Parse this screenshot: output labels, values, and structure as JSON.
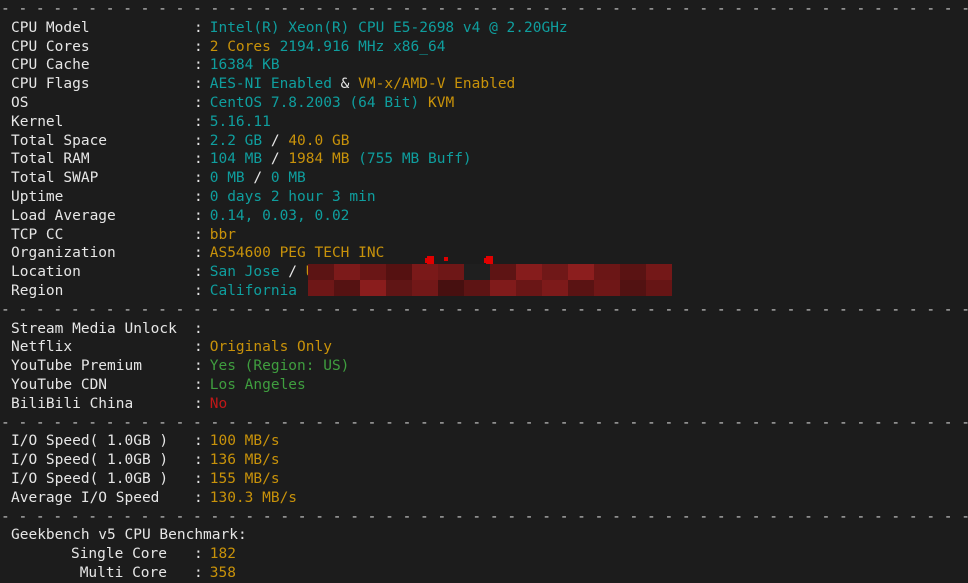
{
  "terminal": {
    "background": "#1c1c1c",
    "colors": {
      "white": "#e6e6e6",
      "cyan": "#0f9e9e",
      "yellow": "#c8920a",
      "green": "#3f9e3f",
      "red": "#c01818",
      "redaction": "#7a1010"
    },
    "divider": "-------------------------------------------------------------",
    "sections": {
      "system": {
        "rows": [
          {
            "label": "CPU Model",
            "parts": [
              {
                "t": "Intel(R) Xeon(R) CPU E5-2698 v4 @ 2.20GHz",
                "c": "cyan"
              }
            ]
          },
          {
            "label": "CPU Cores",
            "parts": [
              {
                "t": "2 Cores",
                "c": "yellow"
              },
              {
                "t": " ",
                "c": "white"
              },
              {
                "t": "2194.916 MHz x86_64",
                "c": "cyan"
              }
            ]
          },
          {
            "label": "CPU Cache",
            "parts": [
              {
                "t": "16384 KB",
                "c": "cyan"
              }
            ]
          },
          {
            "label": "CPU Flags",
            "parts": [
              {
                "t": "AES-NI Enabled",
                "c": "cyan"
              },
              {
                "t": " & ",
                "c": "white"
              },
              {
                "t": "VM-x/AMD-V Enabled",
                "c": "yellow"
              }
            ]
          },
          {
            "label": "OS",
            "parts": [
              {
                "t": "CentOS 7.8.2003 (64 Bit) ",
                "c": "cyan"
              },
              {
                "t": "KVM",
                "c": "yellow"
              }
            ]
          },
          {
            "label": "Kernel",
            "parts": [
              {
                "t": "5.16.11",
                "c": "cyan"
              }
            ]
          },
          {
            "label": "Total Space",
            "parts": [
              {
                "t": "2.2 GB",
                "c": "cyan"
              },
              {
                "t": " / ",
                "c": "white"
              },
              {
                "t": "40.0 GB",
                "c": "yellow"
              }
            ]
          },
          {
            "label": "Total RAM",
            "parts": [
              {
                "t": "104 MB",
                "c": "cyan"
              },
              {
                "t": " / ",
                "c": "white"
              },
              {
                "t": "1984 MB",
                "c": "yellow"
              },
              {
                "t": " (755 MB Buff)",
                "c": "cyan"
              }
            ]
          },
          {
            "label": "Total SWAP",
            "parts": [
              {
                "t": "0 MB",
                "c": "cyan"
              },
              {
                "t": " / ",
                "c": "white"
              },
              {
                "t": "0 MB",
                "c": "cyan"
              }
            ]
          },
          {
            "label": "Uptime",
            "parts": [
              {
                "t": "0 days 2 hour 3 min",
                "c": "cyan"
              }
            ]
          },
          {
            "label": "Load Average",
            "parts": [
              {
                "t": "0.14, 0.03, 0.02",
                "c": "cyan"
              }
            ]
          },
          {
            "label": "TCP CC",
            "parts": [
              {
                "t": "bbr",
                "c": "yellow"
              }
            ]
          },
          {
            "label": "Organization",
            "parts": [
              {
                "t": "AS54600 PEG TECH INC",
                "c": "yellow"
              }
            ]
          },
          {
            "label": "Location",
            "parts": [
              {
                "t": "San Jose",
                "c": "cyan"
              },
              {
                "t": " / ",
                "c": "white"
              },
              {
                "t": "US",
                "c": "yellow"
              }
            ]
          },
          {
            "label": "Region",
            "parts": [
              {
                "t": "California",
                "c": "cyan"
              }
            ]
          }
        ]
      },
      "stream": {
        "title": "Stream Media Unlock",
        "title_colon": ":",
        "rows": [
          {
            "label": "Netflix",
            "parts": [
              {
                "t": "Originals Only",
                "c": "yellow"
              }
            ]
          },
          {
            "label": "YouTube Premium",
            "parts": [
              {
                "t": "Yes (Region: US)",
                "c": "green"
              }
            ]
          },
          {
            "label": "YouTube CDN",
            "parts": [
              {
                "t": "Los Angeles",
                "c": "green"
              }
            ]
          },
          {
            "label": "BiliBili China",
            "parts": [
              {
                "t": "No",
                "c": "red"
              }
            ]
          }
        ]
      },
      "io": {
        "rows": [
          {
            "label": "I/O Speed( 1.0GB )",
            "parts": [
              {
                "t": "100 MB/s",
                "c": "yellow"
              }
            ]
          },
          {
            "label": "I/O Speed( 1.0GB )",
            "parts": [
              {
                "t": "136 MB/s",
                "c": "yellow"
              }
            ]
          },
          {
            "label": "I/O Speed( 1.0GB )",
            "parts": [
              {
                "t": "155 MB/s",
                "c": "yellow"
              }
            ]
          },
          {
            "label": "Average I/O Speed",
            "parts": [
              {
                "t": "130.3 MB/s",
                "c": "yellow"
              }
            ]
          }
        ]
      },
      "geekbench": {
        "title": "Geekbench v5 CPU Benchmark:",
        "rows": [
          {
            "label": "Single Core",
            "parts": [
              {
                "t": "182",
                "c": "yellow"
              }
            ]
          },
          {
            "label": "Multi Core",
            "parts": [
              {
                "t": "358",
                "c": "yellow"
              }
            ]
          }
        ]
      }
    },
    "redaction": {
      "note": "pixelated red censor block covering IP / ASN detail",
      "tiles": [
        "#5c1414",
        "#7c1a1a",
        "#6a1616",
        "#551111",
        "#7a1919",
        "#6e1717",
        "#1f1f1f",
        "#5e1414",
        "#861c1c",
        "#701818",
        "#8c1e1e",
        "#6b1616",
        "#5a1313",
        "#741818",
        "#6e1717",
        "#551212",
        "#8a1d1d",
        "#601515",
        "#721818",
        "#471010",
        "#5d1414",
        "#801b1b",
        "#6a1616",
        "#7d1a1a",
        "#5a1313",
        "#6f1717",
        "#521212",
        "#661515"
      ]
    }
  }
}
